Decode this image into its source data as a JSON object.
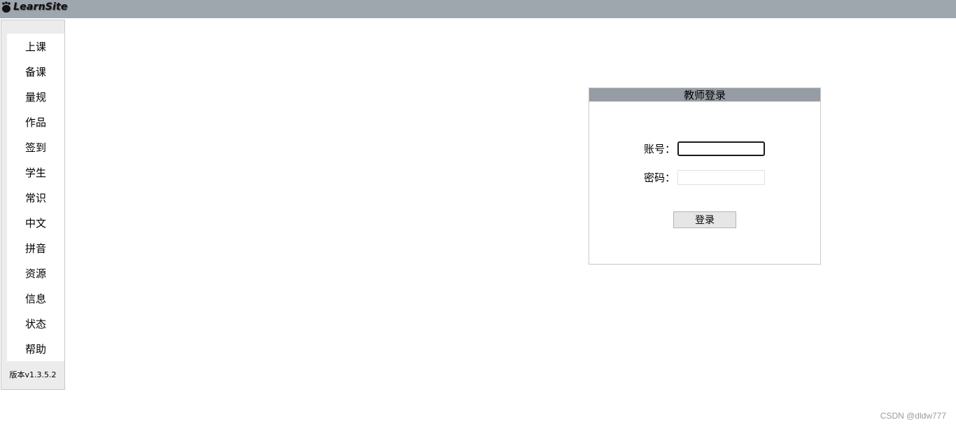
{
  "header": {
    "logo_text": "LearnSite",
    "logo_icon": "paw-icon",
    "background_color": "#9ea6ae"
  },
  "sidebar": {
    "items": [
      {
        "label": "上课"
      },
      {
        "label": "备课"
      },
      {
        "label": "量规"
      },
      {
        "label": "作品"
      },
      {
        "label": "签到"
      },
      {
        "label": "学生"
      },
      {
        "label": "常识"
      },
      {
        "label": "中文"
      },
      {
        "label": "拼音"
      },
      {
        "label": "资源"
      },
      {
        "label": "信息"
      },
      {
        "label": "状态"
      },
      {
        "label": "帮助"
      }
    ],
    "version": "版本v1.3.5.2"
  },
  "login": {
    "title": "教师登录",
    "title_bar_color": "#969ca3",
    "account_label": "账号：",
    "account_value": "",
    "password_label": "密码：",
    "password_value": "",
    "submit_label": "登录"
  },
  "watermark": "CSDN @dldw777"
}
